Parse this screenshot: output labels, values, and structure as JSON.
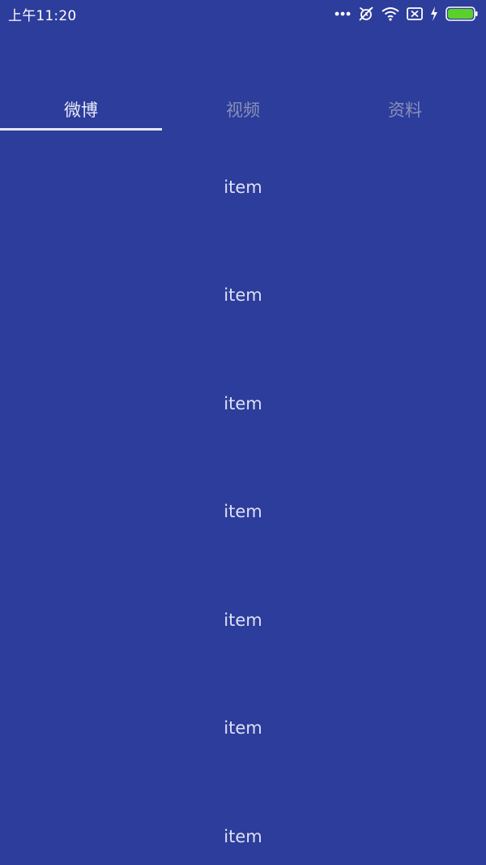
{
  "status_bar": {
    "time": "上午11:20",
    "icons": [
      "more-dots-icon",
      "alarm-off-icon",
      "wifi-icon",
      "sim-x-icon",
      "charging-bolt-icon",
      "battery-icon"
    ],
    "battery_color": "#5ad12a"
  },
  "tabs": [
    {
      "label": "微博",
      "active": true
    },
    {
      "label": "视频",
      "active": false
    },
    {
      "label": "资料",
      "active": false
    }
  ],
  "list": {
    "items": [
      "item",
      "item",
      "item",
      "item",
      "item",
      "item",
      "item"
    ]
  },
  "colors": {
    "background": "#2d3d9c",
    "active_tab_text": "#e8eaf6",
    "inactive_tab_text": "#8a90b6",
    "indicator": "#e6e7ef"
  }
}
